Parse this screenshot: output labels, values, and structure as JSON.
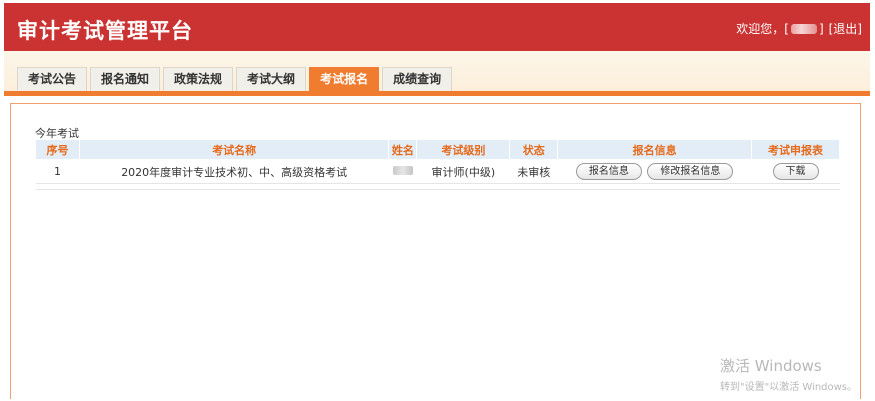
{
  "header": {
    "title": "审计考试管理平台",
    "welcome_prefix": "欢迎您，[",
    "welcome_suffix": "]",
    "logout": "[退出]"
  },
  "nav": {
    "tabs": [
      {
        "label": "考试公告"
      },
      {
        "label": "报名通知"
      },
      {
        "label": "政策法规"
      },
      {
        "label": "考试大纲"
      },
      {
        "label": "考试报名",
        "active": true
      },
      {
        "label": "成绩查询"
      }
    ]
  },
  "main": {
    "section_label": "今年考试",
    "table": {
      "headers": [
        "序号",
        "考试名称",
        "姓名",
        "考试级别",
        "状态",
        "报名信息",
        "考试申报表"
      ],
      "rows": [
        {
          "index": "1",
          "exam_name": "2020年度审计专业技术初、中、高级资格考试",
          "level": "审计师(中级)",
          "status": "未审核",
          "btn_info": "报名信息",
          "btn_edit": "修改报名信息",
          "btn_download": "下载"
        }
      ]
    }
  },
  "watermark": {
    "title": "激活 Windows",
    "subtitle": "转到\"设置\"以激活 Windows。"
  },
  "colors": {
    "header_bg": "#cb3232",
    "accent_orange": "#f07c2f",
    "table_header_bg": "#e3edf7",
    "table_header_text": "#e56a1b"
  }
}
